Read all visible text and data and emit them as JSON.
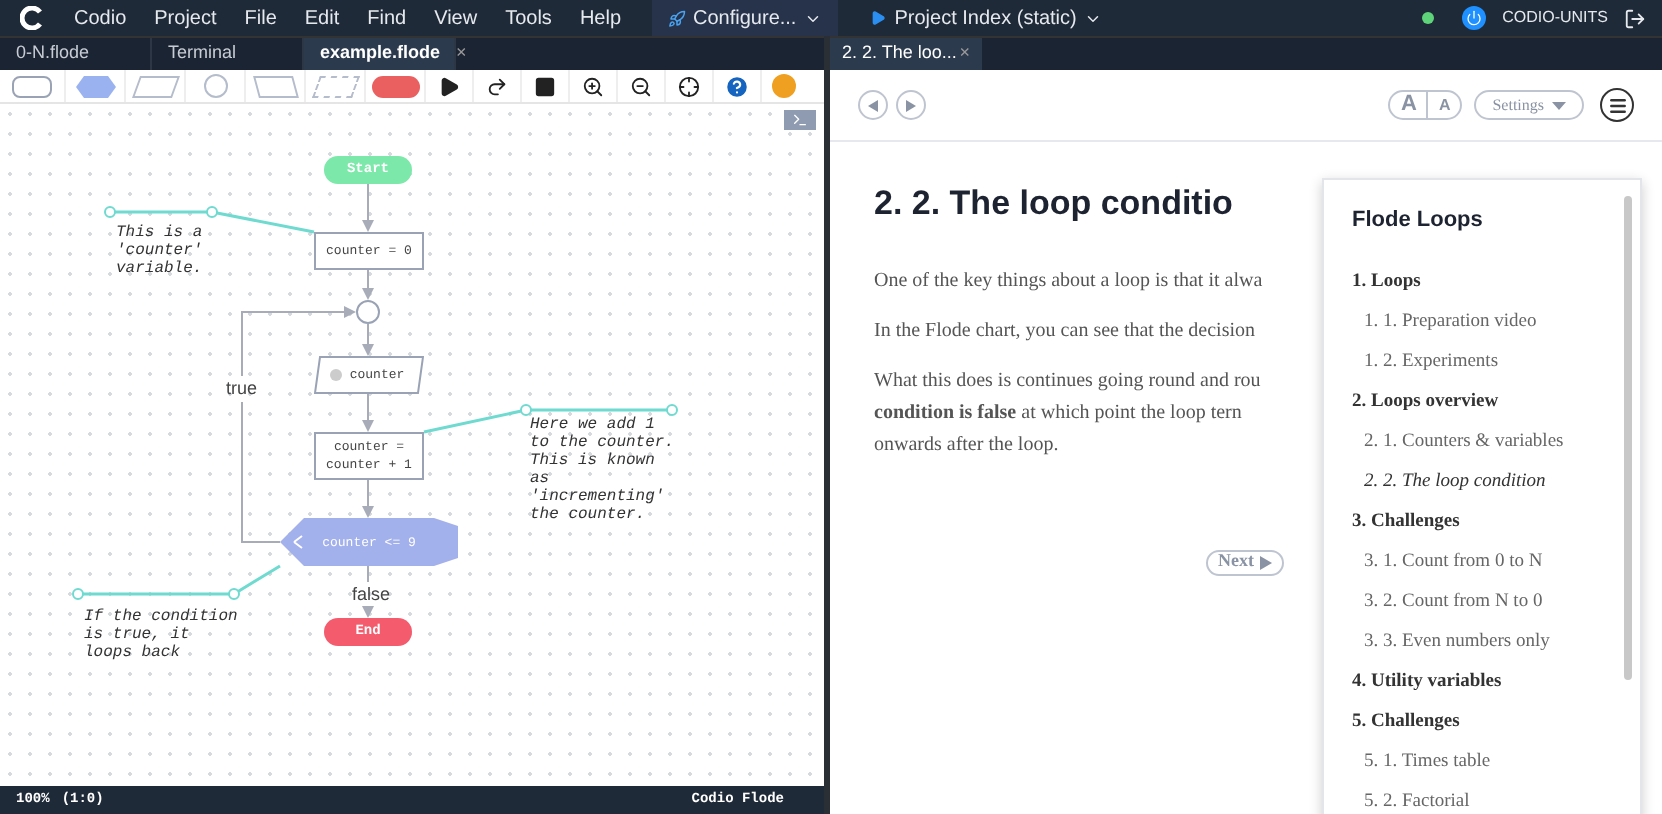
{
  "menubar": {
    "items": [
      "Codio",
      "Project",
      "File",
      "Edit",
      "Find",
      "View",
      "Tools",
      "Help"
    ],
    "configure": "Configure...",
    "preview": "Project Index (static)",
    "online": true,
    "user": "CODIO-UNITS"
  },
  "editor": {
    "tabs": [
      {
        "label": "0-N.flode",
        "selected": false
      },
      {
        "label": "Terminal",
        "selected": false
      },
      {
        "label": "example.flode",
        "selected": true,
        "close": "×"
      }
    ],
    "flowchart": {
      "nodes": [
        {
          "kind": "terminal",
          "label": "Start",
          "color": "#7ce8a9"
        },
        {
          "kind": "process",
          "label": "counter = 0"
        },
        {
          "kind": "junction"
        },
        {
          "kind": "output",
          "label": "counter"
        },
        {
          "kind": "process",
          "label": "counter = counter + 1"
        },
        {
          "kind": "decision",
          "label": "counter <= 9"
        },
        {
          "kind": "terminal",
          "label": "End",
          "color": "#f45b6d"
        }
      ],
      "edge_labels": [
        "true",
        "false"
      ],
      "comments": [
        "This is a 'counter' variable.",
        "Here we add 1 to the counter. This is known as 'incrementing' the counter.",
        "If the condition is true, it loops back"
      ]
    },
    "status_bar": {
      "zoom": "100%",
      "position": "(1:0)",
      "mode": "Codio Flode"
    }
  },
  "guide": {
    "tab": {
      "label": "2. 2. The loo...",
      "selected": true,
      "close": "×"
    },
    "settings": "Settings",
    "font_buttons": [
      "A",
      "A"
    ],
    "heading": "2. 2. The loop conditio",
    "paragraphs": [
      {
        "lines": [
          "One of the key things about a loop is that it alwa"
        ]
      },
      {
        "lines": [
          "In the Flode chart, you can see that the decision"
        ]
      },
      {
        "lines": [
          "What this does is continues going round and rou",
          "**condition is false** at which point the loop tern",
          "onwards after the loop."
        ]
      }
    ],
    "next": "Next",
    "toc": {
      "open": true,
      "title": "Flode Loops",
      "sections": [
        {
          "label": "1. Loops",
          "children": [
            {
              "label": "1. 1. Preparation video",
              "selected": false
            },
            {
              "label": "1. 2. Experiments",
              "selected": false
            }
          ]
        },
        {
          "label": "2. Loops overview",
          "children": [
            {
              "label": "2. 1. Counters & variables",
              "selected": false
            },
            {
              "label": "2. 2. The loop condition",
              "selected": true
            }
          ]
        },
        {
          "label": "3. Challenges",
          "children": [
            {
              "label": "3. 1. Count from 0 to N",
              "selected": false
            },
            {
              "label": "3. 2. Count from N to 0",
              "selected": false
            },
            {
              "label": "3. 3. Even numbers only",
              "selected": false
            }
          ]
        },
        {
          "label": "4. Utility variables"
        },
        {
          "label": "5. Challenges",
          "children": [
            {
              "label": "5. 1. Times table",
              "selected": false
            },
            {
              "label": "5. 2. Factorial",
              "selected": false
            }
          ]
        }
      ]
    }
  }
}
